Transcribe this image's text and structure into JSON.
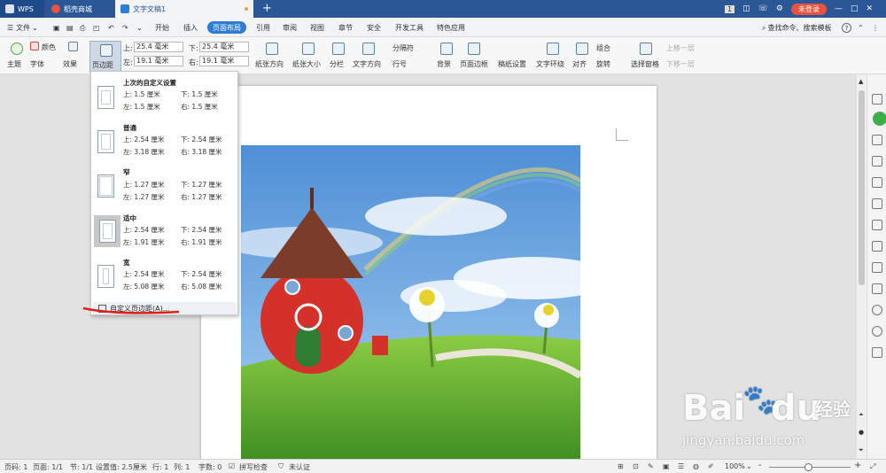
{
  "titlebar": {
    "tabs": [
      {
        "label": "WPS"
      },
      {
        "label": "稻壳商城"
      },
      {
        "label": "文字文稿1"
      }
    ],
    "new_tab": "+",
    "badge": "1",
    "login": "未登录"
  },
  "menubar": {
    "file": "文件",
    "items": [
      "开始",
      "插入",
      "页面布局",
      "引用",
      "审阅",
      "视图",
      "章节",
      "安全",
      "开发工具",
      "特色应用"
    ],
    "active": "页面布局",
    "search": "查找命令、搜索模板",
    "help": "?"
  },
  "ribbon": {
    "theme": "主题",
    "colors": "颜色",
    "fonts": "字体",
    "effects": "效果",
    "margins": "页边距",
    "top_label": "上:",
    "top_value": "25.4 毫米",
    "bottom_label": "下:",
    "bottom_value": "25.4 毫米",
    "left_label": "左:",
    "left_value": "19.1 毫米",
    "right_label": "右:",
    "right_value": "19.1 毫米",
    "orientation": "纸张方向",
    "size": "纸张大小",
    "columns": "分栏",
    "text_direction": "文字方向",
    "breaks": "分隔符",
    "line_numbers": "行号",
    "background": "背景",
    "page_border": "页面边框",
    "grid_paper": "稿纸设置",
    "wrap_text": "文字环绕",
    "align": "对齐",
    "group": "组合",
    "rotate": "旋转",
    "selection_pane": "选择窗格",
    "bring_forward": "上移一层",
    "send_backward": "下移一层"
  },
  "margin_presets": [
    {
      "name": "上次的自定义设置",
      "top": "上: 1.5 厘米",
      "bottom": "下: 1.5 厘米",
      "left": "左: 1.5 厘米",
      "right": "右: 1.5 厘米"
    },
    {
      "name": "普通",
      "top": "上: 2.54 厘米",
      "bottom": "下: 2.54 厘米",
      "left": "左: 3.18 厘米",
      "right": "右: 3.18 厘米"
    },
    {
      "name": "窄",
      "top": "上: 1.27 厘米",
      "bottom": "下: 1.27 厘米",
      "left": "左: 1.27 厘米",
      "right": "右: 1.27 厘米"
    },
    {
      "name": "适中",
      "top": "上: 2.54 厘米",
      "bottom": "下: 2.54 厘米",
      "left": "左: 1.91 厘米",
      "right": "右: 1.91 厘米"
    },
    {
      "name": "宽",
      "top": "上: 2.54 厘米",
      "bottom": "下: 2.54 厘米",
      "left": "左: 5.08 厘米",
      "right": "右: 5.08 厘米"
    }
  ],
  "custom_margins": "自定义页边距(A)...",
  "watermark": {
    "line1": "Bai",
    "line1b": "du",
    "suffix": "经验",
    "url": "jingyan.baidu.com"
  },
  "status": {
    "page_num": "页码: 1",
    "pages": "页面: 1/1",
    "section": "节: 1/1",
    "set_value": "设置值: 2.5厘米",
    "row": "行: 1",
    "col": "列: 1",
    "words": "字数: 0",
    "spell": "拼写检查",
    "cert": "未认证",
    "zoom": "100%",
    "minus": "-",
    "plus": "+"
  }
}
